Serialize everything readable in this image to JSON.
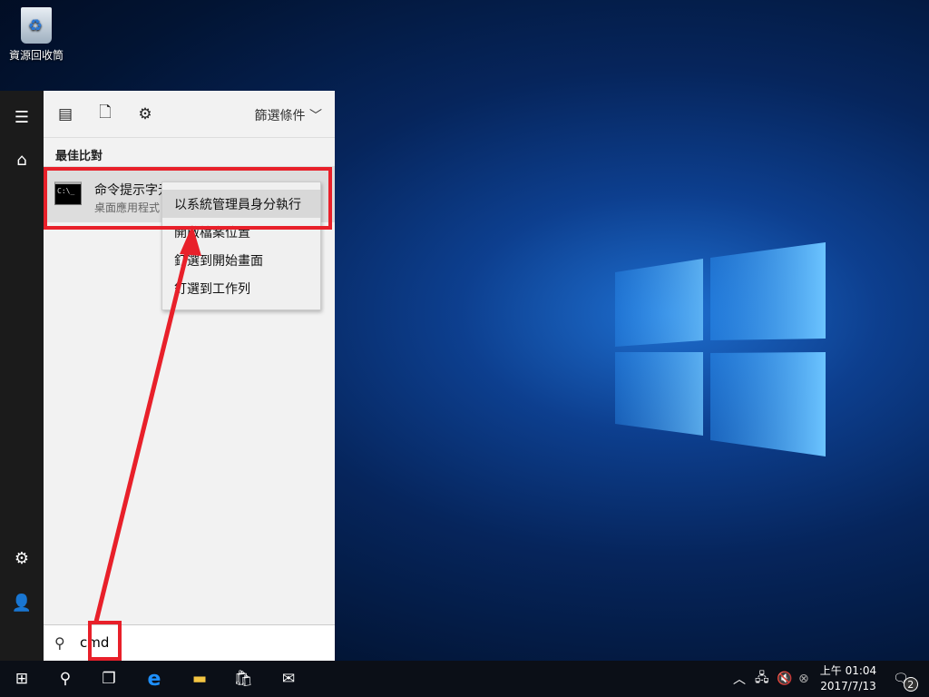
{
  "desktop": {
    "recycle_bin_label": "資源回收筒"
  },
  "start_rail": {
    "menu": "hamburger-icon",
    "home": "home-icon",
    "settings": "gear-icon",
    "user": "user-icon"
  },
  "search_panel": {
    "filter_label": "篩選條件",
    "section_title": "最佳比對",
    "result": {
      "title": "命令提示字元",
      "subtitle": "桌面應用程式",
      "icon_text": "C:\\_"
    },
    "search_value": "cmd"
  },
  "context_menu": {
    "items": [
      {
        "label": "以系統管理員身分執行"
      },
      {
        "label": "開啟檔案位置"
      },
      {
        "label": "釘選到開始畫面"
      },
      {
        "label": "釘選到工作列"
      }
    ]
  },
  "taskbar": {
    "clock_time": "上午 01:04",
    "clock_date": "2017/7/13",
    "notification_count": "2"
  },
  "colors": {
    "highlight": "#e8202a",
    "rail": "#1b1b1b",
    "panel": "#f2f2f2"
  }
}
